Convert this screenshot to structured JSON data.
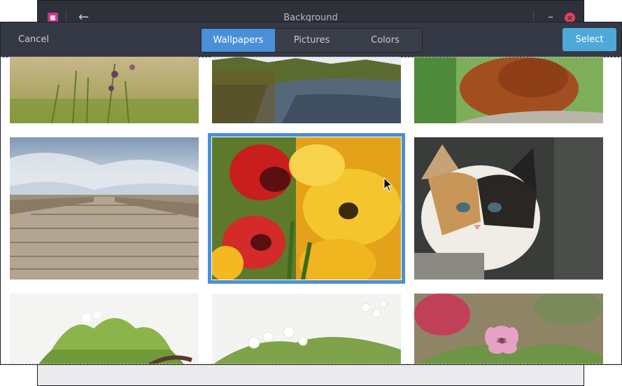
{
  "parent_window": {
    "title": "Background",
    "back_icon": "arrow-left-icon",
    "minimize_label": "–",
    "close_label": "×"
  },
  "dialog": {
    "cancel_label": "Cancel",
    "select_label": "Select",
    "tabs": [
      {
        "label": "Wallpapers",
        "active": true
      },
      {
        "label": "Pictures",
        "active": false
      },
      {
        "label": "Colors",
        "active": false
      }
    ]
  },
  "wallpapers": [
    {
      "name": "meadow-flowers",
      "selected": false
    },
    {
      "name": "forest-lake",
      "selected": false
    },
    {
      "name": "orangutan",
      "selected": false
    },
    {
      "name": "wooden-boardwalk",
      "selected": false
    },
    {
      "name": "red-yellow-tulips",
      "selected": true
    },
    {
      "name": "calico-kitten",
      "selected": false
    },
    {
      "name": "hawthorn-leaves",
      "selected": false
    },
    {
      "name": "white-blossoms",
      "selected": false
    },
    {
      "name": "pink-flower",
      "selected": false
    }
  ],
  "colors": {
    "accent": "#4a90d9",
    "select_button": "#4fa9d8",
    "header": "#353945",
    "close_button": "#e2405a"
  }
}
